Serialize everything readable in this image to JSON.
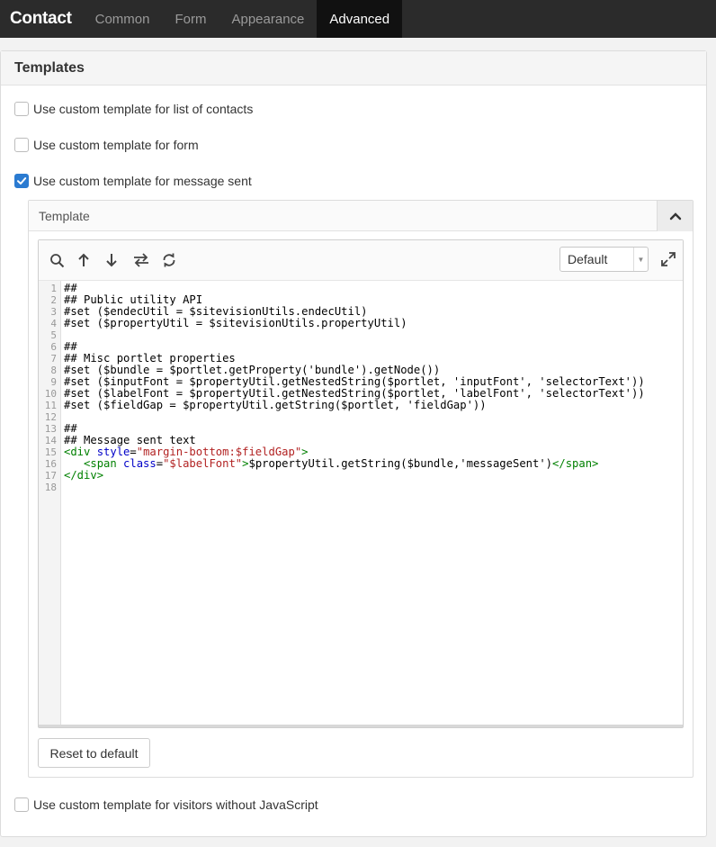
{
  "app": {
    "brand": "Contact"
  },
  "tabs": [
    {
      "label": "Common"
    },
    {
      "label": "Form"
    },
    {
      "label": "Appearance"
    },
    {
      "label": "Advanced"
    }
  ],
  "panel": {
    "title": "Templates",
    "options": [
      {
        "label": "Use custom template for list of contacts",
        "checked": false
      },
      {
        "label": "Use custom template for form",
        "checked": false
      },
      {
        "label": "Use custom template for message sent",
        "checked": true
      },
      {
        "label": "Use custom template for visitors without JavaScript",
        "checked": false
      }
    ]
  },
  "template": {
    "title": "Template",
    "theme_select": "Default",
    "reset_label": "Reset to default",
    "line_numbers": [
      "1",
      "2",
      "3",
      "4",
      "5",
      "6",
      "7",
      "8",
      "9",
      "10",
      "11",
      "12",
      "13",
      "14",
      "15",
      "16",
      "17",
      "18"
    ],
    "code_lines": [
      "##",
      "## Public utility API",
      "#set ($endecUtil = $sitevisionUtils.endecUtil)",
      "#set ($propertyUtil = $sitevisionUtils.propertyUtil)",
      "",
      "##",
      "## Misc portlet properties",
      "#set ($bundle = $portlet.getProperty('bundle').getNode())",
      "#set ($inputFont = $propertyUtil.getNestedString($portlet, 'inputFont', 'selectorText'))",
      "#set ($labelFont = $propertyUtil.getNestedString($portlet, 'labelFont', 'selectorText'))",
      "#set ($fieldGap = $propertyUtil.getString($portlet, 'fieldGap'))",
      "",
      "##",
      "## Message sent text",
      "<div style=\"margin-bottom:$fieldGap\">",
      "   <span class=\"$labelFont\">$propertyUtil.getString($bundle,'messageSent')</span>",
      "</div>",
      ""
    ]
  },
  "icons": {
    "search": "search-icon",
    "up": "arrow-up-icon",
    "down": "arrow-down-icon",
    "swap": "swap-icon",
    "refresh": "refresh-icon",
    "expand": "expand-icon",
    "collapse": "chevron-up-icon"
  },
  "colors": {
    "topbar": "#2b2b2b",
    "active_tab": "#111111",
    "checkbox": "#2b7bd1"
  }
}
